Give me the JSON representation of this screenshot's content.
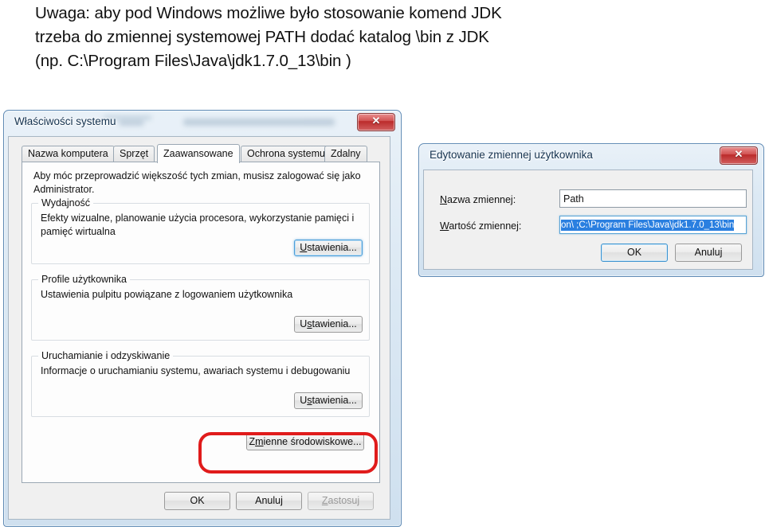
{
  "note": {
    "lines": [
      "Uwaga: aby pod Windows możliwe było stosowanie komend JDK",
      "trzeba do zmiennej systemowej PATH dodać katalog \\bin z JDK",
      "(np. C:\\Program Files\\Java\\jdk1.7.0_13\\bin )"
    ]
  },
  "system_properties": {
    "title": "Właściwości systemu",
    "close_icon": "close-icon",
    "close_glyph": "✕",
    "tabs": [
      {
        "label": "Nazwa komputera",
        "active": false
      },
      {
        "label": "Sprzęt",
        "active": false
      },
      {
        "label": "Zaawansowane",
        "active": true
      },
      {
        "label": "Ochrona systemu",
        "active": false
      },
      {
        "label": "Zdalny",
        "active": false
      }
    ],
    "admin_notice": "Aby móc przeprowadzić większość tych zmian, musisz zalogować się jako Administrator.",
    "groups": [
      {
        "legend": "Wydajność",
        "description": "Efekty wizualne, planowanie użycia procesora, wykorzystanie pamięci i pamięć wirtualna",
        "button": {
          "pre": "U",
          "key": "",
          "post": "stawienia..."
        }
      },
      {
        "legend": "Profile użytkownika",
        "description": "Ustawienia pulpitu powiązane z logowaniem użytkownika",
        "button": {
          "pre": "U",
          "key": "s",
          "post": "tawienia..."
        }
      },
      {
        "legend": "Uruchamianie i odzyskiwanie",
        "description": "Informacje o uruchamianiu systemu, awariach systemu i debugowaniu",
        "button": {
          "pre": "U",
          "key": "s",
          "post": "tawienia..."
        }
      }
    ],
    "env_button": {
      "pre": "Z",
      "key": "m",
      "post": "ienne środowiskowe..."
    },
    "footer_buttons": [
      {
        "pre": "OK",
        "key": "",
        "post": "",
        "state": "normal"
      },
      {
        "pre": "Anuluj",
        "key": "",
        "post": "",
        "state": "normal"
      },
      {
        "pre": "",
        "key": "Z",
        "post": "astosuj",
        "state": "disabled"
      }
    ]
  },
  "edit_variable": {
    "title": "Edytowanie zmiennej użytkownika",
    "close_icon": "close-icon",
    "close_glyph": "✕",
    "fields": [
      {
        "label_key": "N",
        "label_rest": "azwa zmiennej:",
        "value": "Path",
        "selected": false
      },
      {
        "label_key": "W",
        "label_rest": "artość zmiennej:",
        "value": "on\\ ;C:\\Program Files\\Java\\jdk1.7.0_13\\bin",
        "selected": true
      }
    ],
    "buttons": [
      {
        "label": "OK",
        "state": "default"
      },
      {
        "label": "Anuluj",
        "state": "normal"
      }
    ]
  },
  "colors": {
    "accent_red": "#e01b1b",
    "selection_blue": "#2a7fe0",
    "window_border": "#5f8ab4",
    "close_red": "#bb2a2a"
  }
}
